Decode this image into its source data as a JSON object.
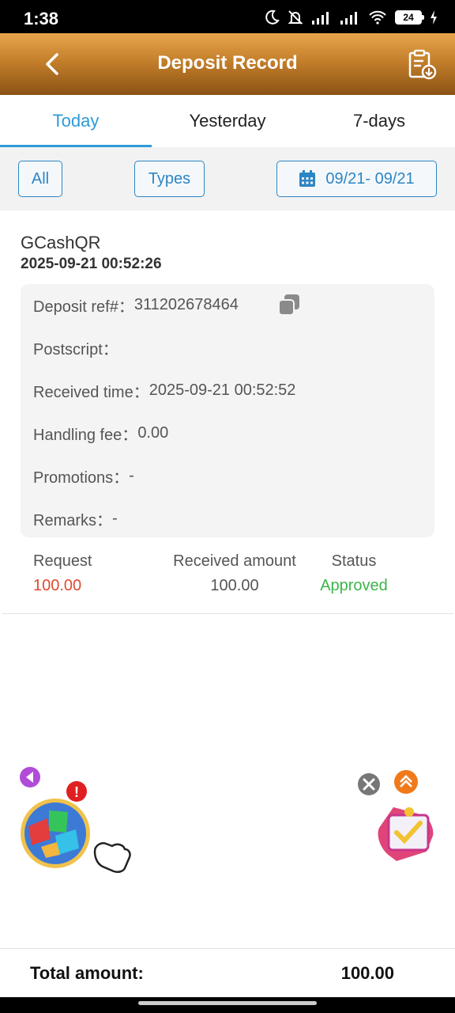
{
  "status_bar": {
    "time": "1:38",
    "battery": "24"
  },
  "header": {
    "title": "Deposit Record"
  },
  "tabs": [
    {
      "label": "Today",
      "active": true
    },
    {
      "label": "Yesterday",
      "active": false
    },
    {
      "label": "7-days",
      "active": false
    }
  ],
  "filters": {
    "all_label": "All",
    "types_label": "Types",
    "date_range": "09/21- 09/21"
  },
  "record": {
    "method": "GCashQR",
    "time": "2025-09-21 00:52:26",
    "details": {
      "deposit_ref_label": "Deposit ref#：",
      "deposit_ref_value": "311202678464",
      "postscript_label": "Postscript：",
      "postscript_value": "",
      "received_time_label": "Received time：",
      "received_time_value": "2025-09-21 00:52:52",
      "handling_fee_label": "Handling fee：",
      "handling_fee_value": "0.00",
      "promotions_label": "Promotions：",
      "promotions_value": "-",
      "remarks_label": "Remarks：",
      "remarks_value": "-"
    },
    "summary": {
      "request_label": "Request",
      "request_value": "100.00",
      "received_label": "Received amount",
      "received_value": "100.00",
      "status_label": "Status",
      "status_value": "Approved"
    }
  },
  "total": {
    "label": "Total amount:",
    "value": "100.00"
  },
  "colors": {
    "accent": "#2d9bd8",
    "request": "#e04a2f",
    "approved": "#3cb54a",
    "header": "#c47f2b"
  },
  "icons": [
    "back-icon",
    "download-record-icon",
    "calendar-icon",
    "copy-icon",
    "close-icon",
    "arrow-up-icon",
    "alert-icon"
  ]
}
